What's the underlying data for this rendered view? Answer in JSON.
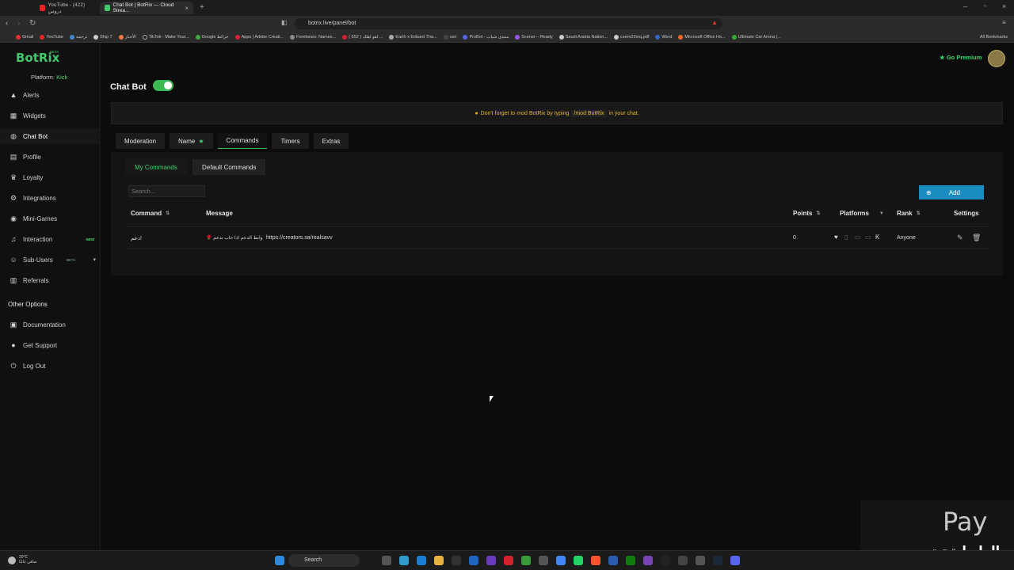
{
  "browser": {
    "tabs": [
      {
        "label": "YouTube - (422) دروس",
        "active": false
      },
      {
        "label": "Chat Bot | BotRix — Cloud Strea...",
        "active": true
      }
    ],
    "url": "botrix.live/panel/bot",
    "bookmarks": [
      "Gmail",
      "YouTube",
      "ترجمة",
      "Ship 7",
      "الأخبار",
      "TikTok - Make Your...",
      "Google خرائط",
      "Apps | Adobe Creati...",
      "Forebears: Names...",
      "اهو اهلك ( 652 ) ...",
      "Earth x Eobard Tha...",
      "osn",
      "ProBot - منتدى شباب",
      "Scener – Ready",
      "Saudi Arabia Nation...",
      "ceem22mq.pdf",
      "Word",
      "Microsoft Office Ho...",
      "Ultimate Car Arena |..."
    ],
    "all_bookmarks": "All Bookmarks"
  },
  "brand": {
    "logo": "BotRix",
    "beta": "BETA",
    "platform_label": "Platform:",
    "platform_value": "Kick",
    "accent": "#3fc76a"
  },
  "sidebar": {
    "items": [
      {
        "label": "Alerts",
        "icon": "alert-icon"
      },
      {
        "label": "Widgets",
        "icon": "widgets-icon"
      },
      {
        "label": "Chat Bot",
        "icon": "bot-icon",
        "active": true
      },
      {
        "label": "Profile",
        "icon": "profile-icon"
      },
      {
        "label": "Loyalty",
        "icon": "trophy-icon"
      },
      {
        "label": "Integrations",
        "icon": "integrations-icon"
      },
      {
        "label": "Mini-Games",
        "icon": "gamepad-icon"
      },
      {
        "label": "Interaction",
        "icon": "music-icon",
        "badge": "NEW"
      },
      {
        "label": "Sub-Users",
        "icon": "users-icon",
        "badge": "BETA"
      },
      {
        "label": "Referrals",
        "icon": "referrals-icon"
      }
    ],
    "other_heading": "Other Options",
    "other_items": [
      {
        "label": "Documentation",
        "icon": "document-icon"
      },
      {
        "label": "Get Support",
        "icon": "support-icon"
      },
      {
        "label": "Log Out",
        "icon": "logout-icon"
      }
    ]
  },
  "header": {
    "go_premium": "Go Premium"
  },
  "main": {
    "title": "Chat Bot",
    "notice": {
      "prefix": "Don't forget to mod BotRix by typing",
      "command": "/mod BotRix",
      "suffix": "in your chat."
    },
    "tabs": [
      "Moderation",
      "Name",
      "Commands",
      "Timers",
      "Extras"
    ],
    "active_tab": "Commands",
    "subtabs": [
      "My Commands",
      "Default Commands"
    ],
    "search_placeholder": "Search...",
    "add_label": "Add",
    "columns": {
      "command": "Command",
      "message": "Message",
      "points": "Points",
      "platforms": "Platforms",
      "rank": "Rank",
      "settings": "Settings"
    },
    "rows": [
      {
        "command": "دعم!",
        "message_prefix": "وابط الدعم اذا حاب تدعم 🌹",
        "message_link": "https://creators.sa/realsavv",
        "points": "0",
        "rank": "Anyone"
      }
    ]
  },
  "taskbar": {
    "search": "Search",
    "weather_temp": "20°C",
    "weather_desc": "صافي غالبًا"
  },
  "overlay": {
    "pay_text": "Pay",
    "arabic_text": "الرابط تحت"
  }
}
